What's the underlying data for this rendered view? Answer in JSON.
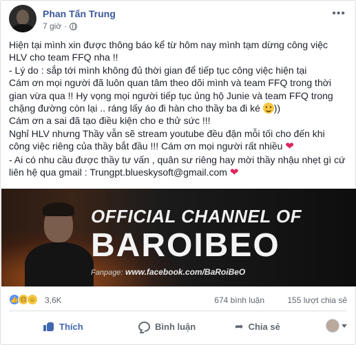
{
  "post": {
    "author": "Phan Tấn Trung",
    "timestamp": "7 giờ",
    "privacy_icon": "globe-icon",
    "more_icon": "more-icon"
  },
  "content": {
    "lines": [
      "Hiện tại mình xin được thông báo kể từ hôm nay mình tạm dừng công việc",
      "HLV cho team FFQ nha !!",
      "- Lý do : sắp tới mình không đủ thời gian để tiếp tục công việc hiện tại",
      "Cám ơn mọi người đã luôn quan tâm theo dõi mình và team FFQ trong thời",
      "gian vừa qua !! Hy vọng mọi người tiếp tục ủng hộ Junie và team FFQ trong",
      "chặng đường còn lại .. ráng lấy áo đi hàn cho thầy ba đi ké",
      "Cám ơn a sai đã tạo điều kiện cho e thử sức !!!",
      "Nghỉ HLV nhưng Thầy vẫn sẽ stream youtube đều đặn mỗi tối cho đến khi",
      "công việc riêng của thầy bắt đầu !!! Cám ơn mọi người rất nhiều",
      "- Ai có nhu cầu được thầy tư vấn , quân sư riêng hay mời thầy nhậu nhẹt gì cứ",
      "liên hệ qua gmail : Trungpt.blueskysoft@gmail.com"
    ],
    "line6_suffix": "))"
  },
  "banner": {
    "title": "OFFICIAL CHANNEL OF",
    "name": "BAROIBEO",
    "fanpage_label": "Fanpage:",
    "fanpage_url": "www.facebook.com/BaRoiBeO"
  },
  "reactions": {
    "icons": [
      "like-icon",
      "sad-icon",
      "haha-icon"
    ],
    "count": "3,6K",
    "comments": "674 bình luận",
    "shares": "155 lượt chia sẻ"
  },
  "actions": {
    "like": "Thích",
    "comment": "Bình luận",
    "share": "Chia sẻ"
  },
  "colors": {
    "link": "#385898",
    "like_blue": "#4267b2",
    "heart": "#e0245e",
    "muted": "#606770"
  }
}
